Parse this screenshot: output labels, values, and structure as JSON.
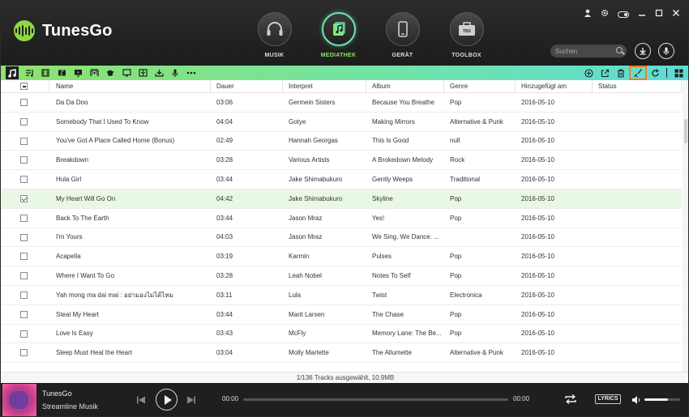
{
  "app": {
    "title": "TunesGo"
  },
  "nav": {
    "items": [
      {
        "label": "MUSIK",
        "icon": "headphones-icon",
        "active": false
      },
      {
        "label": "MEDIATHEK",
        "icon": "media-library-icon",
        "active": true
      },
      {
        "label": "GERÄT",
        "icon": "phone-icon",
        "active": false
      },
      {
        "label": "TOOLBOX",
        "icon": "toolbox-icon",
        "active": false
      }
    ]
  },
  "header": {
    "search_placeholder": "Suchen",
    "toolbox_badge": "TBX"
  },
  "toolbar": {
    "left_icons": [
      "music-icon",
      "playlist-icon",
      "movie-icon",
      "music-video-icon",
      "tv-show-icon",
      "podcast-icon",
      "itunes-u-icon",
      "home-video-icon",
      "audiobook-icon",
      "download-icon",
      "voice-memo-icon",
      "more-icon"
    ],
    "right_icons": [
      "add-icon",
      "export-icon",
      "delete-icon",
      "clean-up-icon",
      "refresh-icon",
      "grid-view-icon"
    ],
    "highlight_color": "#ff7a1a"
  },
  "table": {
    "columns": [
      "Name",
      "Dauer",
      "Interpret",
      "Album",
      "Genre",
      "Hinzugefügt am",
      "Status"
    ],
    "rows": [
      {
        "name": "Da Da Doo",
        "duration": "03:06",
        "artist": "Germein Sisters",
        "album": "Because You Breathe",
        "genre": "Pop",
        "added": "2016-05-10",
        "checked": false
      },
      {
        "name": "Somebody That I Used To Know",
        "duration": "04:04",
        "artist": "Gotye",
        "album": "Making Mirrors",
        "genre": "Alternative & Punk",
        "added": "2016-05-10",
        "checked": false
      },
      {
        "name": "You've Got A Place Called Home (Bonus)",
        "duration": "02:49",
        "artist": "Hannah Georgas",
        "album": "This Is Good",
        "genre": "null",
        "added": "2016-05-10",
        "checked": false
      },
      {
        "name": "Breakdown",
        "duration": "03:28",
        "artist": "Various Artists",
        "album": "A Brokedown Melody",
        "genre": "Rock",
        "added": "2016-05-10",
        "checked": false
      },
      {
        "name": "Hula Girl",
        "duration": "03:44",
        "artist": "Jake Shimabukuro",
        "album": "Gently Weeps",
        "genre": "Traditional",
        "added": "2016-05-10",
        "checked": false
      },
      {
        "name": "My Heart Will Go On",
        "duration": "04:42",
        "artist": "Jake Shimabukuro",
        "album": "Skyline",
        "genre": "Pop",
        "added": "2016-05-10",
        "checked": true
      },
      {
        "name": "Back To The Earth",
        "duration": "03:44",
        "artist": "Jason Mraz",
        "album": "Yes!",
        "genre": "Pop",
        "added": "2016-05-10",
        "checked": false
      },
      {
        "name": "I'm Yours",
        "duration": "04:03",
        "artist": "Jason Mraz",
        "album": "We Sing. We Dance. ...",
        "genre": "",
        "added": "2016-05-10",
        "checked": false
      },
      {
        "name": "Acapella",
        "duration": "03:19",
        "artist": "Karmin",
        "album": "Pulses",
        "genre": "Pop",
        "added": "2016-05-10",
        "checked": false
      },
      {
        "name": "Where I Want To Go",
        "duration": "03:28",
        "artist": "Leah Nobel",
        "album": "Notes To Self",
        "genre": "Pop",
        "added": "2016-05-10",
        "checked": false
      },
      {
        "name": "Yah mong ma dai mai : อย่ามองไม่ได้ไหม",
        "duration": "03:11",
        "artist": "Lula",
        "album": "Twist",
        "genre": "Electronica",
        "added": "2016-05-10",
        "checked": false
      },
      {
        "name": "Steal My Heart",
        "duration": "03:44",
        "artist": "Marit Larsen",
        "album": "The Chase",
        "genre": "Pop",
        "added": "2016-05-10",
        "checked": false
      },
      {
        "name": "Love Is Easy",
        "duration": "03:43",
        "artist": "McFly",
        "album": "Memory Lane: The Be...",
        "genre": "Pop",
        "added": "2016-05-10",
        "checked": false
      },
      {
        "name": "Sleep Must Heal the Heart",
        "duration": "03:04",
        "artist": "Molly Marlette",
        "album": "The Allumette",
        "genre": "Alternative & Punk",
        "added": "2016-05-10",
        "checked": false
      }
    ]
  },
  "status": {
    "text": "1/136 Tracks ausgewählt, 10.9MB"
  },
  "player": {
    "title": "TunesGo",
    "subtitle": "Streamline Musik",
    "time_current": "00:00",
    "time_total": "00:00",
    "lyrics_label": "LYRICS",
    "volume": 0.65,
    "progress": 0
  }
}
